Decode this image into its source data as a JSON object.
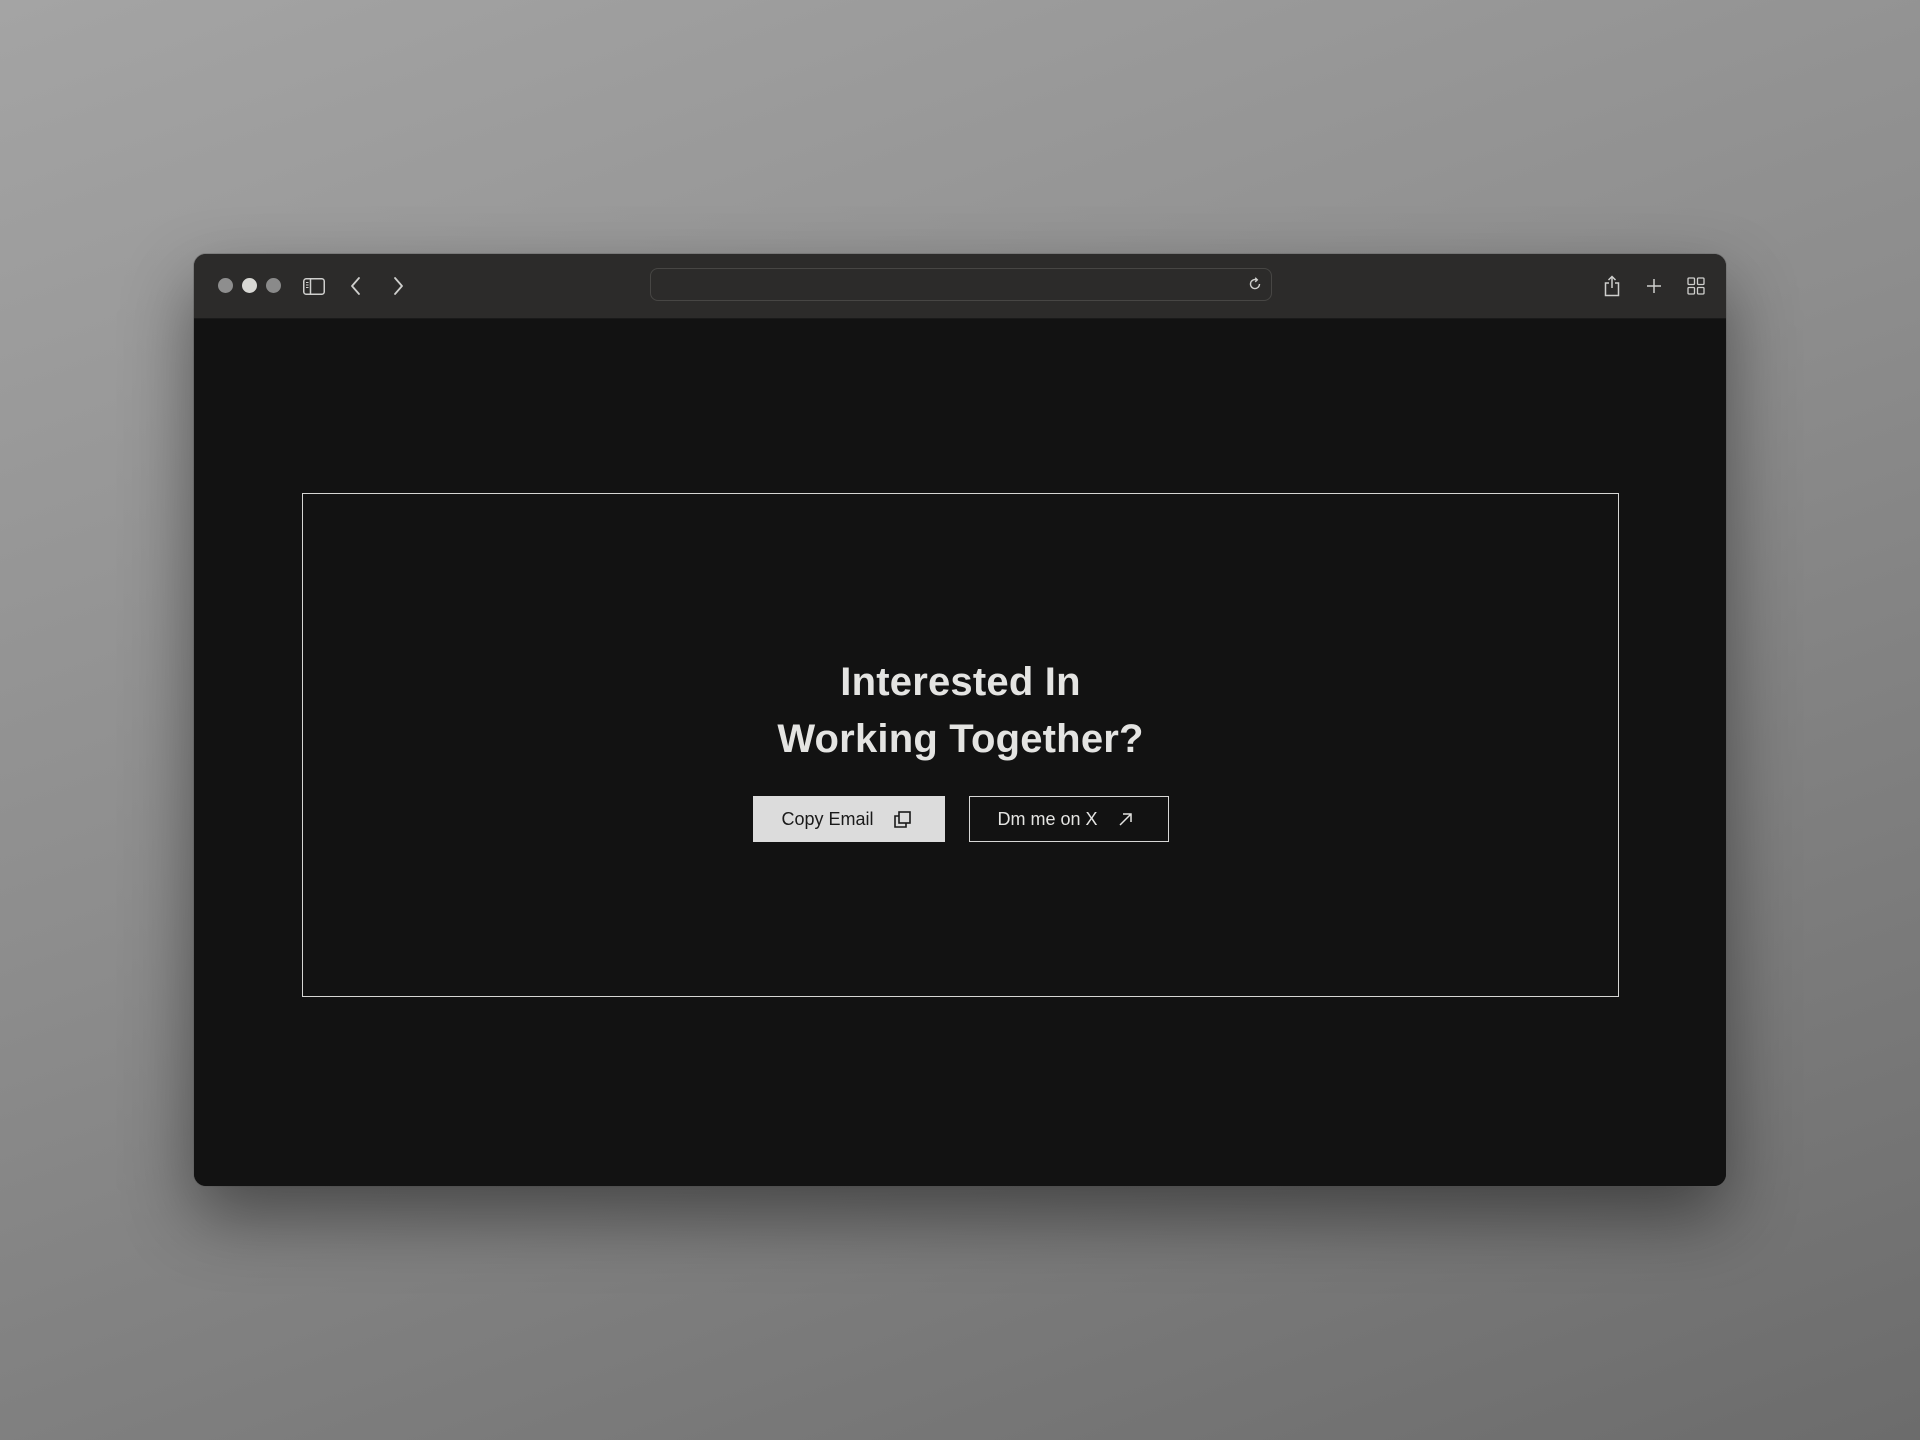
{
  "browser": {
    "window_controls": [
      "close",
      "minimize",
      "maximize"
    ],
    "toolbar_icons": {
      "sidebar": "sidebar-icon",
      "back": "chevron-left-icon",
      "forward": "chevron-right-icon",
      "reload": "reload-icon",
      "share": "share-icon",
      "new_tab": "plus-icon",
      "tab_overview": "grid-icon"
    },
    "url": ""
  },
  "main": {
    "heading_line1": "Interested In",
    "heading_line2": "Working Together?",
    "buttons": [
      {
        "label": "Copy Email",
        "icon": "copy-icon"
      },
      {
        "label": "Dm me on X",
        "icon": "arrow-up-right-icon"
      }
    ]
  },
  "colors": {
    "page_bg": "#121212",
    "toolbar_bg": "#2c2b2a",
    "text": "#e4e4e2",
    "primary_button_bg": "#dcdcdc"
  }
}
